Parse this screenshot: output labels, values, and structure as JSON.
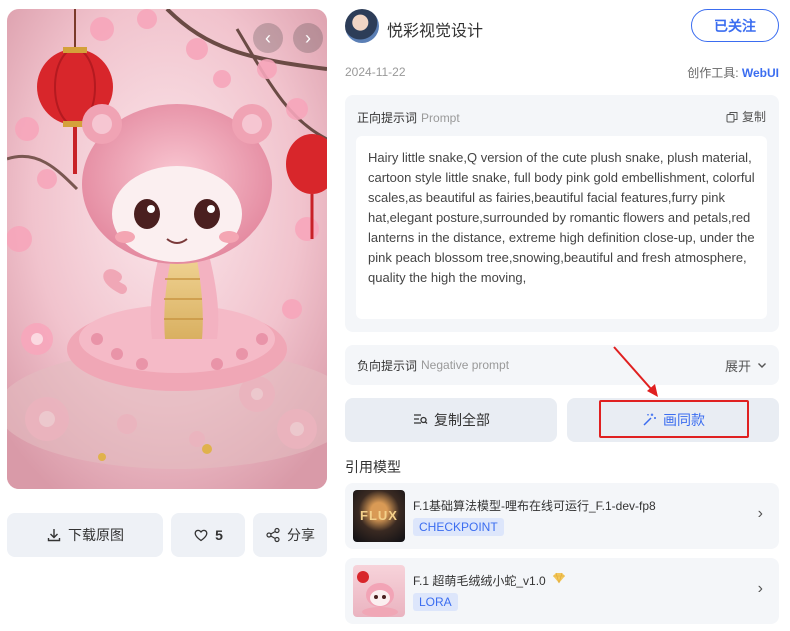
{
  "author": {
    "name": "悦彩视觉设计",
    "follow_label": "已关注"
  },
  "meta": {
    "date": "2024-11-22",
    "tool_label": "创作工具:",
    "tool_name": "WebUI"
  },
  "prompt": {
    "label": "正向提示词",
    "label_en": "Prompt",
    "copy_label": "复制",
    "text": "Hairy little snake,Q version of the cute plush snake, plush material, cartoon style little snake, full body pink gold embellishment, colorful scales,as beautiful as fairies,beautiful facial features,furry pink hat,elegant posture,surrounded by romantic flowers and petals,red lanterns in the distance, extreme high definition close-up, under the pink peach blossom tree,snowing,beautiful and fresh atmosphere, quality the high the moving,"
  },
  "negative_prompt": {
    "label": "负向提示词",
    "label_en": "Negative prompt",
    "expand_label": "展开"
  },
  "actions": {
    "copy_all_label": "复制全部",
    "draw_same_label": "画同款"
  },
  "left_actions": {
    "download_label": "下载原图",
    "like_count": "5",
    "share_label": "分享"
  },
  "models_section": {
    "title": "引用模型",
    "items": [
      {
        "name": "F.1基础算法模型-哩布在线可运行_F.1-dev-fp8",
        "badge": "CHECKPOINT",
        "thumb_text": "FLUX"
      },
      {
        "name": "F.1 超萌毛绒绒小蛇_v1.0",
        "badge": "LORA"
      }
    ]
  },
  "colors": {
    "accent": "#3b6df0",
    "highlight": "#e02020",
    "panel_bg": "#f4f6f9"
  }
}
